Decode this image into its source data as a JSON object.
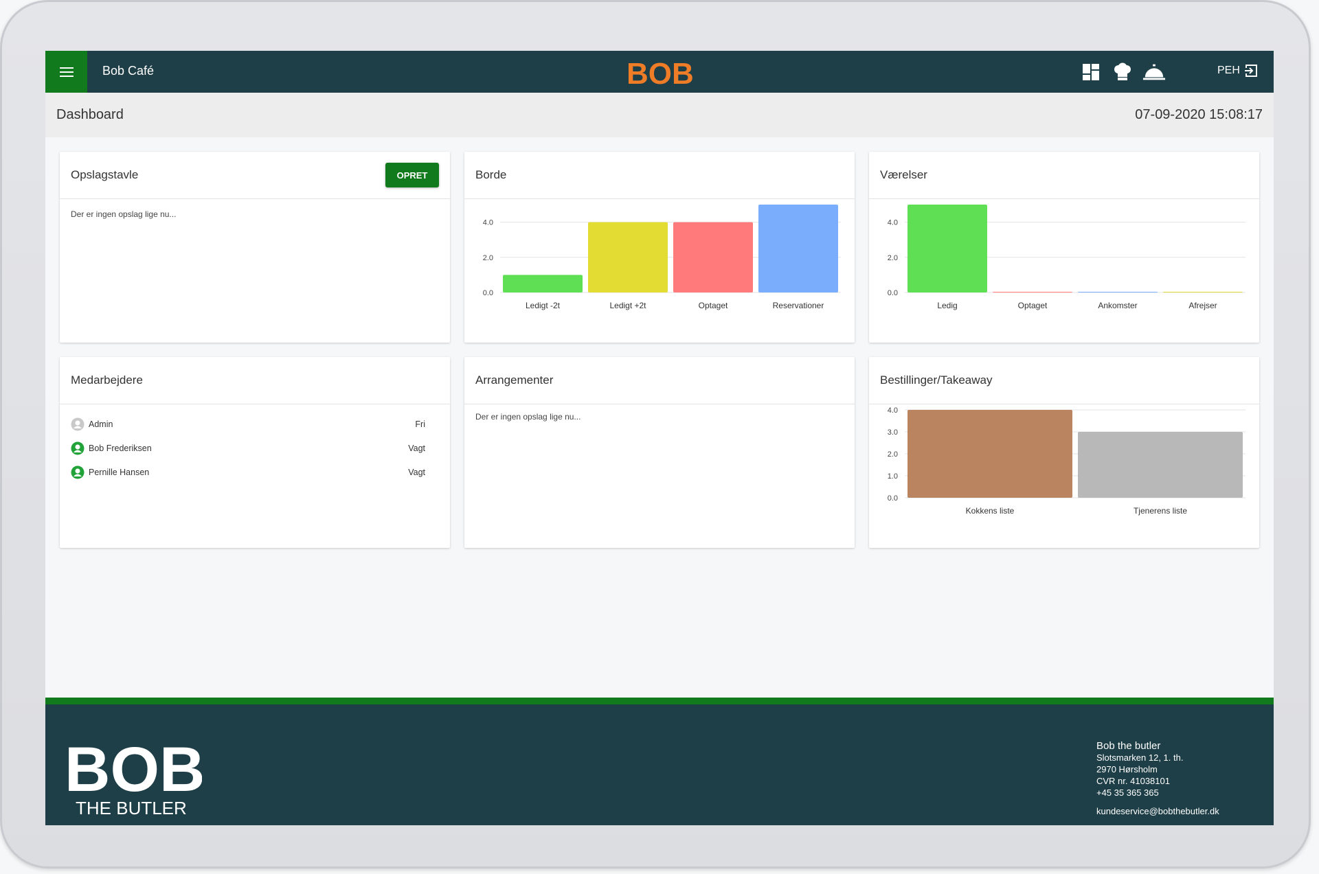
{
  "header": {
    "menu_icon": "hamburger-menu-icon",
    "app_title": "Bob Café",
    "logo_text": "BOB",
    "nav_icons": [
      "dashboard-grid-icon",
      "chef-hat-icon",
      "service-bell-icon"
    ],
    "user_initials": "PEH",
    "logout_icon": "logout-icon"
  },
  "subheader": {
    "page_title": "Dashboard",
    "datetime": "07-09-2020 15:08:17"
  },
  "colors": {
    "header_bg": "#1e3f47",
    "brand_green": "#117a1c",
    "logo_orange": "#ef7c27"
  },
  "cards": {
    "board": {
      "title": "Opslagstavle",
      "button_label": "OPRET",
      "empty_message": "Der er ingen opslag lige nu..."
    },
    "tables": {
      "title": "Borde"
    },
    "rooms": {
      "title": "Værelser"
    },
    "staff": {
      "title": "Medarbejdere",
      "items": [
        {
          "name": "Admin",
          "status": "Fri",
          "active": false
        },
        {
          "name": "Bob Frederiksen",
          "status": "Vagt",
          "active": true
        },
        {
          "name": "Pernille Hansen",
          "status": "Vagt",
          "active": true
        }
      ]
    },
    "events": {
      "title": "Arrangementer",
      "empty_message": "Der er ingen opslag lige nu..."
    },
    "orders": {
      "title": "Bestillinger/Takeaway"
    }
  },
  "chart_data": [
    {
      "id": "tables",
      "type": "bar",
      "categories": [
        "Ledigt -2t",
        "Ledigt +2t",
        "Optaget",
        "Reservationer"
      ],
      "values": [
        1,
        4,
        4,
        5
      ],
      "colors": [
        "#5fe054",
        "#e2dc33",
        "#ff7b7b",
        "#7aaefc"
      ],
      "ticks": [
        "0.0",
        "2.0",
        "4.0"
      ],
      "tick_values": [
        0,
        2,
        4
      ],
      "ylim": [
        0,
        5
      ],
      "grid": true
    },
    {
      "id": "rooms",
      "type": "bar",
      "categories": [
        "Ledig",
        "Optaget",
        "Ankomster",
        "Afrejser"
      ],
      "values": [
        5,
        0,
        0,
        0
      ],
      "colors": [
        "#5fe054",
        "#ff7b7b",
        "#7aaefc",
        "#e2dc33"
      ],
      "ticks": [
        "0.0",
        "2.0",
        "4.0"
      ],
      "tick_values": [
        0,
        2,
        4
      ],
      "ylim": [
        0,
        5
      ],
      "grid": true
    },
    {
      "id": "orders",
      "type": "bar",
      "categories": [
        "Kokkens liste",
        "Tjenerens liste"
      ],
      "values": [
        4,
        3
      ],
      "colors": [
        "#b9845f",
        "#b8b8b8"
      ],
      "ticks": [
        "0.0",
        "1.0",
        "2.0",
        "3.0",
        "4.0"
      ],
      "tick_values": [
        0,
        1,
        2,
        3,
        4
      ],
      "ylim": [
        0,
        4
      ],
      "grid": true
    }
  ],
  "footer": {
    "logo_text": "BOB",
    "logo_subtitle": "THE BUTLER",
    "company_name": "Bob the butler",
    "address_line1": "Slotsmarken 12, 1. th.",
    "address_line2": "2970 Hørsholm",
    "cvr": "CVR nr. 41038101",
    "phone": "+45 35 365 365",
    "email": "kundeservice@bobthebutler.dk"
  }
}
